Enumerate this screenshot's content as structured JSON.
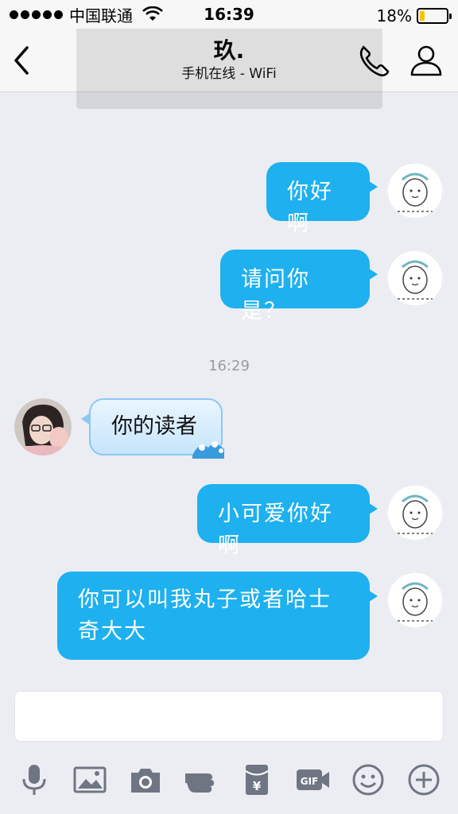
{
  "status_bar": {
    "carrier": "中国联通",
    "time": "16:39",
    "battery": "18%",
    "battery_level": 0.18
  },
  "nav": {
    "title": "玖.",
    "subtitle": "手机在线 - WiFi"
  },
  "messages": [
    {
      "text": "你好啊"
    },
    {
      "text": "请问你是？"
    },
    {
      "text": "16:29"
    },
    {
      "text": "你的读者"
    },
    {
      "text": "小可爱你好啊"
    },
    {
      "text": "你可以叫我丸子或者哈士奇大大"
    }
  ],
  "input": {
    "placeholder": ""
  },
  "colors": {
    "outgoing_bubble": "#1eb0ef",
    "incoming_bubble": "#d6ecfb",
    "background": "#ebedf2"
  },
  "toolbar_icons": [
    "microphone-icon",
    "image-icon",
    "camera-icon",
    "poke-icon",
    "red-packet-icon",
    "gif-icon",
    "emoji-icon",
    "plus-icon"
  ]
}
